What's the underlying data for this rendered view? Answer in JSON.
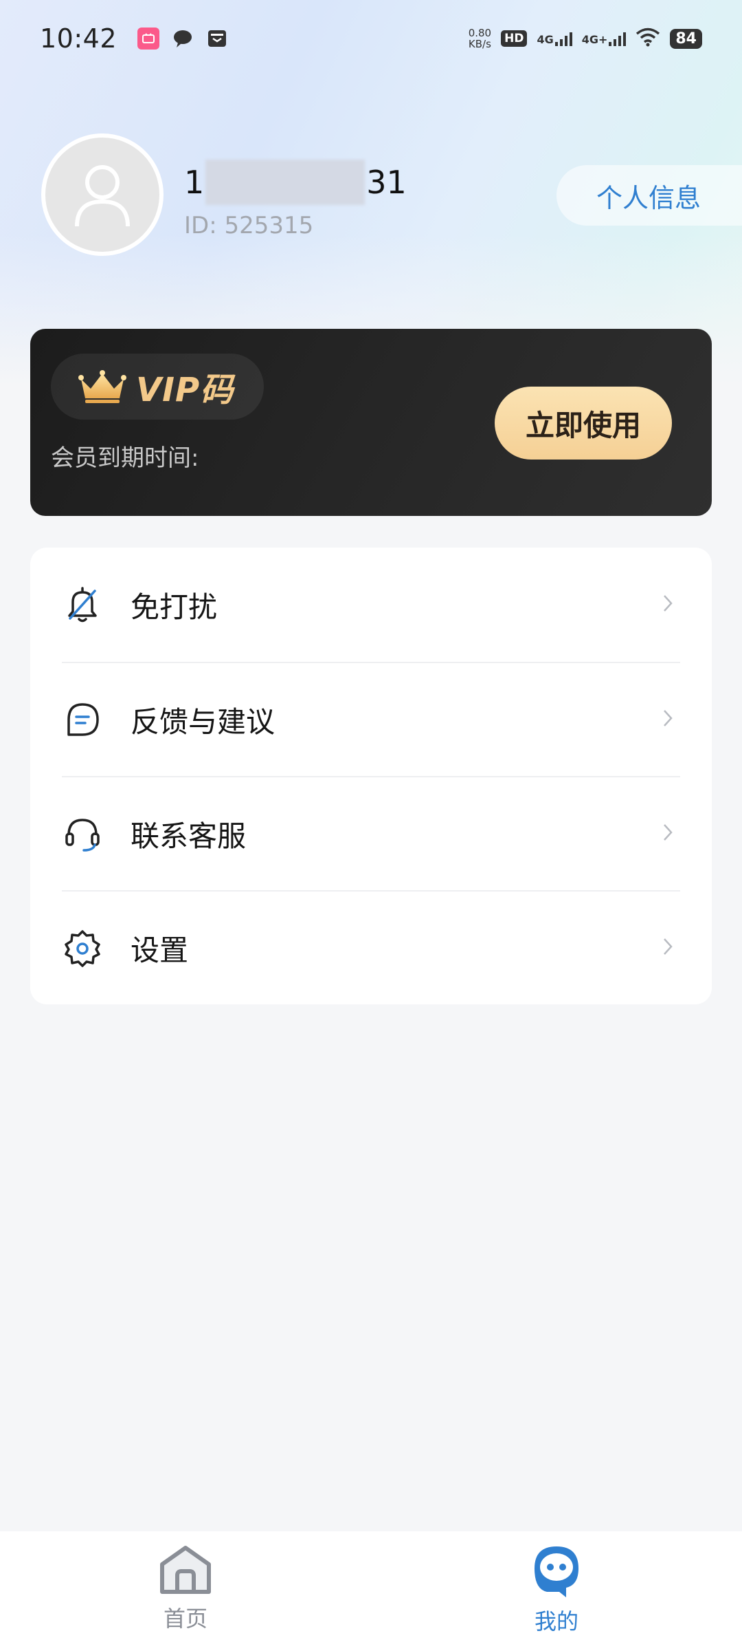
{
  "status_bar": {
    "time": "10:42",
    "net_speed_value": "0.80",
    "net_speed_unit": "KB/s",
    "hd_badge": "HD",
    "signal_1": "4G",
    "signal_2": "4G+",
    "battery": "84",
    "notification_icons": [
      "bilibili-icon",
      "chat-bubble-icon",
      "inbox-icon"
    ]
  },
  "profile": {
    "phone_prefix": "1",
    "phone_suffix": "31",
    "id_text": "ID:  525315",
    "info_button": "个人信息"
  },
  "vip": {
    "title": "VIP码",
    "expire_label": "会员到期时间:",
    "use_button": "立即使用",
    "crown_icon": "crown-icon"
  },
  "menu": {
    "items": [
      {
        "label": "免打扰",
        "icon": "bell-off-icon"
      },
      {
        "label": "反馈与建议",
        "icon": "chat-feedback-icon"
      },
      {
        "label": "联系客服",
        "icon": "headset-icon"
      },
      {
        "label": "设置",
        "icon": "gear-icon"
      }
    ]
  },
  "bottom_nav": {
    "home": "首页",
    "mine": "我的",
    "active": "mine"
  },
  "colors": {
    "accent_blue": "#2f7fd0",
    "vip_gold": "#f3c98a",
    "vip_button": "#f5d095"
  }
}
